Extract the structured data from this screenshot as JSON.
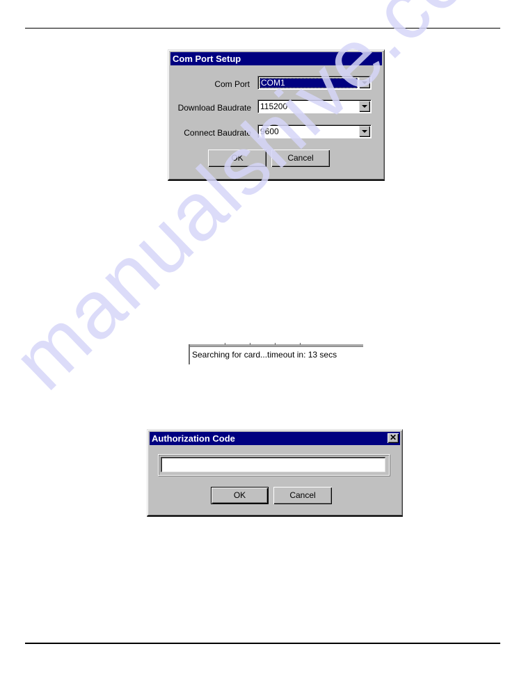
{
  "page": {
    "watermark": "manualshive.com"
  },
  "com_port_dialog": {
    "title": "Com Port Setup",
    "fields": [
      {
        "label": "Com Port",
        "value": "COM1",
        "focused": true
      },
      {
        "label": "Download Baudrate",
        "value": "115200",
        "focused": false
      },
      {
        "label": "Connect Baudrate",
        "value": "9600",
        "focused": false
      }
    ],
    "ok_label": "OK",
    "cancel_label": "Cancel"
  },
  "status_bar": {
    "text": "Searching for card...timeout in: 13 secs"
  },
  "auth_dialog": {
    "title": "Authorization Code",
    "close_glyph": "✕",
    "input_value": "",
    "ok_label": "OK",
    "cancel_label": "Cancel"
  }
}
